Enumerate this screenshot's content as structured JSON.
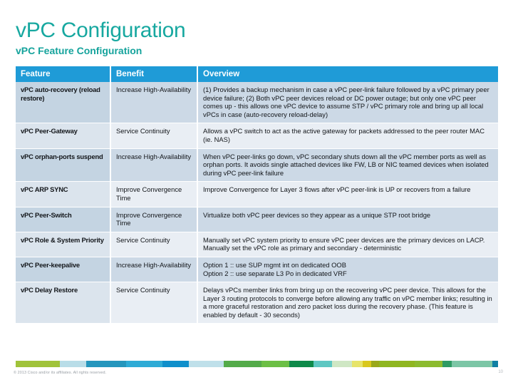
{
  "slide": {
    "title": "vPC Configuration",
    "subtitle": "vPC Feature Configuration",
    "title_color": "#17a8a0",
    "subtitle_color": "#15a39c"
  },
  "table": {
    "header_bg": "#1f9bd7",
    "header_text_color": "#ffffff",
    "row_band_light": "#e9eef4",
    "row_band_dark": "#ccd9e6",
    "columns": [
      "Feature",
      "Benefit",
      "Overview"
    ],
    "rows": [
      {
        "feature": "vPC auto-recovery (reload restore)",
        "benefit": "Increase High-Availability",
        "overview": "(1) Provides a backup mechanism in case a vPC peer-link failure followed by a vPC primary peer device failure; (2) Both vPC peer devices reload or DC power outage; but only one vPC peer comes up - this allows one vPC device to assume STP / vPC primary role and bring up all local vPCs in case (auto-recovery reload-delay)"
      },
      {
        "feature": "vPC Peer-Gateway",
        "benefit": "Service Continuity",
        "overview": "Allows a vPC switch to act as the active gateway for packets addressed to the peer router MAC (ie. NAS)"
      },
      {
        "feature": "vPC orphan-ports suspend",
        "benefit": "Increase High-Availability",
        "overview": "When vPC peer-links go down, vPC secondary shuts down all the vPC member ports as well as orphan ports. It avoids single attached devices like FW, LB or NIC teamed devices when isolated during vPC peer-link failure"
      },
      {
        "feature": "vPC ARP SYNC",
        "benefit": "Improve Convergence Time",
        "overview": "Improve Convergence for Layer 3 flows after vPC peer-link is UP or recovers from a failure"
      },
      {
        "feature": "vPC Peer-Switch",
        "benefit": "Improve Convergence Time",
        "overview": "Virtualize both vPC peer devices so they appear as a unique STP root bridge"
      },
      {
        "feature": "vPC Role & System Priority",
        "benefit": "Service Continuity",
        "overview": "Manually set vPC system priority to ensure vPC peer devices are the primary devices on LACP.  Manually set the vPC role as primary and secondary - deterministic"
      },
      {
        "feature": "vPC Peer-keepalive",
        "benefit": "Increase High-Availability",
        "overview": "Option 1 :: use SUP mgmt int on dedicated OOB\nOption 2 :: use separate L3 Po in dedicated VRF"
      },
      {
        "feature": "vPC Delay Restore",
        "benefit": "Service Continuity",
        "overview": "Delays vPCs member links from bring up on the recovering vPC peer device. This allows for the Layer 3 routing protocols to converge before allowing any traffic on vPC member links; resulting in a more graceful restoration and zero packet loss during the recovery phase.  (This feature is enabled by default - 30 seconds)"
      }
    ]
  },
  "color_bar": {
    "segments": [
      {
        "color": "#a0c33a",
        "width": 75
      },
      {
        "color": "#b9dde8",
        "width": 44
      },
      {
        "color": "#2596bd",
        "width": 68
      },
      {
        "color": "#2eabd6",
        "width": 62
      },
      {
        "color": "#0f8fcb",
        "width": 44
      },
      {
        "color": "#bfe0ea",
        "width": 60
      },
      {
        "color": "#54ab4a",
        "width": 63
      },
      {
        "color": "#6cbf45",
        "width": 48
      },
      {
        "color": "#0e8a4a",
        "width": 40
      },
      {
        "color": "#5ec7c2",
        "width": 32
      },
      {
        "color": "#cfe7c4",
        "width": 34
      },
      {
        "color": "#e7e469",
        "width": 18
      },
      {
        "color": "#d9c81c",
        "width": 14
      },
      {
        "color": "#9aa81a",
        "width": 14
      },
      {
        "color": "#8fb620",
        "width": 60
      },
      {
        "color": "#8cbb2e",
        "width": 47
      },
      {
        "color": "#2e9b63",
        "width": 16
      },
      {
        "color": "#7cc6a6",
        "width": 68
      },
      {
        "color": "#0f7fa3",
        "width": 10
      }
    ]
  },
  "footer": {
    "copyright": "© 2013 Cisco and/or its affiliates. All rights reserved.",
    "page_number": "10"
  }
}
